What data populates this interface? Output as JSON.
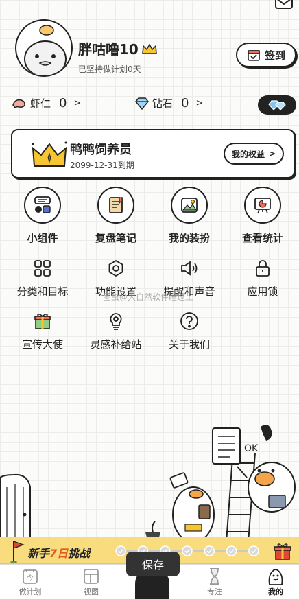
{
  "header": {
    "username": "胖咕噜10",
    "streak_text": "已坚持做计划0天",
    "checkin_label": "签到"
  },
  "currency": {
    "shrimp_label": "虾仁",
    "shrimp_value": "0",
    "diamond_label": "钻石",
    "diamond_value": "0",
    "chevron": ">"
  },
  "vip": {
    "title": "鸭鸭饲养员",
    "expiry": "2099-12-31到期",
    "rights_label": "我的权益",
    "rights_chevron": ">"
  },
  "big_grid": [
    {
      "label": "小组件",
      "icon": "widget-icon"
    },
    {
      "label": "复盘笔记",
      "icon": "notebook-icon"
    },
    {
      "label": "我的装扮",
      "icon": "picture-icon"
    },
    {
      "label": "查看统计",
      "icon": "chart-board-icon"
    }
  ],
  "small_grid": [
    {
      "label": "分类和目标",
      "icon": "grid-icon"
    },
    {
      "label": "功能设置",
      "icon": "settings-icon"
    },
    {
      "label": "提醒和声音",
      "icon": "speaker-icon"
    },
    {
      "label": "应用锁",
      "icon": "lock-icon"
    },
    {
      "label": "宣传大使",
      "icon": "gift-icon"
    },
    {
      "label": "灵感补给站",
      "icon": "lightbulb-icon"
    },
    {
      "label": "关于我们",
      "icon": "question-icon"
    }
  ],
  "watermark": "图虫@大自然软件睡过工",
  "scene": {
    "ok_text": "OK"
  },
  "challenge": {
    "prefix": "新手",
    "highlight": "7日",
    "suffix": "挑战",
    "days_completed": 0,
    "days_total": 7
  },
  "save_label": "保存",
  "nav": [
    {
      "label": "做计划",
      "icon": "calendar-today-icon",
      "active": false
    },
    {
      "label": "视图",
      "icon": "view-icon",
      "active": false
    },
    {
      "label": "专注",
      "icon": "hourglass-icon",
      "active": false
    },
    {
      "label": "我的",
      "icon": "duck-profile-icon",
      "active": true
    }
  ],
  "colors": {
    "accent_yellow": "#f8dc7e",
    "highlight_orange": "#e25b1c",
    "ink": "#222222"
  }
}
